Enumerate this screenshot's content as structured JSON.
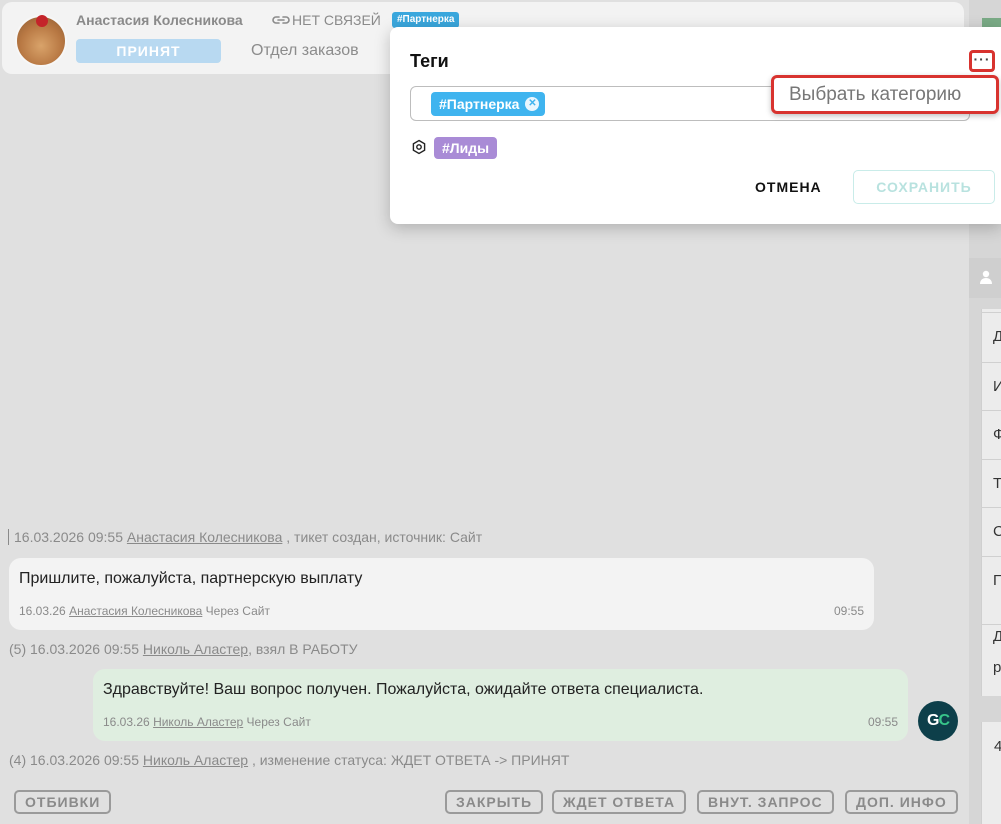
{
  "header": {
    "user_name": "Анастасия Колесникова",
    "link_status": "НЕТ СВЯЗЕЙ",
    "tag": "#Партнерка",
    "status": "ПРИНЯТ",
    "department": "Отдел заказов"
  },
  "feed": {
    "created": {
      "date": "16.03.2026 09:55",
      "user": "Анастасия Колесникова",
      "text": ", тикет создан, источник: Сайт"
    },
    "msg1": {
      "text": "Пришлите, пожалуйста, партнерскую выплату",
      "date": "16.03.26",
      "user": "Анастасия Колесникова",
      "via": "Через Сайт",
      "time": "09:55"
    },
    "event1": {
      "prefix": "(5) 16.03.2026 09:55",
      "user": "Николь Аластер",
      "text": ", взял В РАБОТУ"
    },
    "msg2": {
      "text": "Здравствуйте! Ваш вопрос получен. Пожалуйста, ожидайте ответа специалиста.",
      "date": "16.03.26",
      "user": "Николь Аластер",
      "via": "Через Сайт",
      "time": "09:55"
    },
    "agent_initials": {
      "g": "G",
      "c": "C"
    },
    "event2": {
      "prefix": "(4) 16.03.2026 09:55",
      "user": "Николь Аластер",
      "text": ", изменение статуса: ЖДЕТ ОТВЕТА -> ПРИНЯТ"
    }
  },
  "actions": {
    "rejections": "ОТБИВКИ",
    "close": "ЗАКРЫТЬ",
    "awaiting": "ЖДЕТ ОТВЕТА",
    "internal": "ВНУТ. ЗАПРОС",
    "more_info": "ДОП. ИНФО"
  },
  "modal": {
    "title": "Теги",
    "more": "···",
    "selected_tag": "#Партнерка",
    "remove": "✕",
    "available_tag": "#Лиды",
    "cancel": "ОТМЕНА",
    "save": "СОХРАНИТЬ"
  },
  "dropdown": {
    "item": "Выбрать категорию"
  },
  "sidebar": {
    "row_letters": [
      "Д",
      "И",
      "Ф",
      "Т",
      "С",
      "П",
      "Д",
      "р"
    ],
    "bottom_char": "4"
  },
  "colors": {
    "accent_blue": "#3fb4ef",
    "tag_purple": "#a98bd6",
    "highlight_red": "#d8332f",
    "agent_bubble": "#dfeee0",
    "agent_avatar": "#0d3f4a"
  }
}
